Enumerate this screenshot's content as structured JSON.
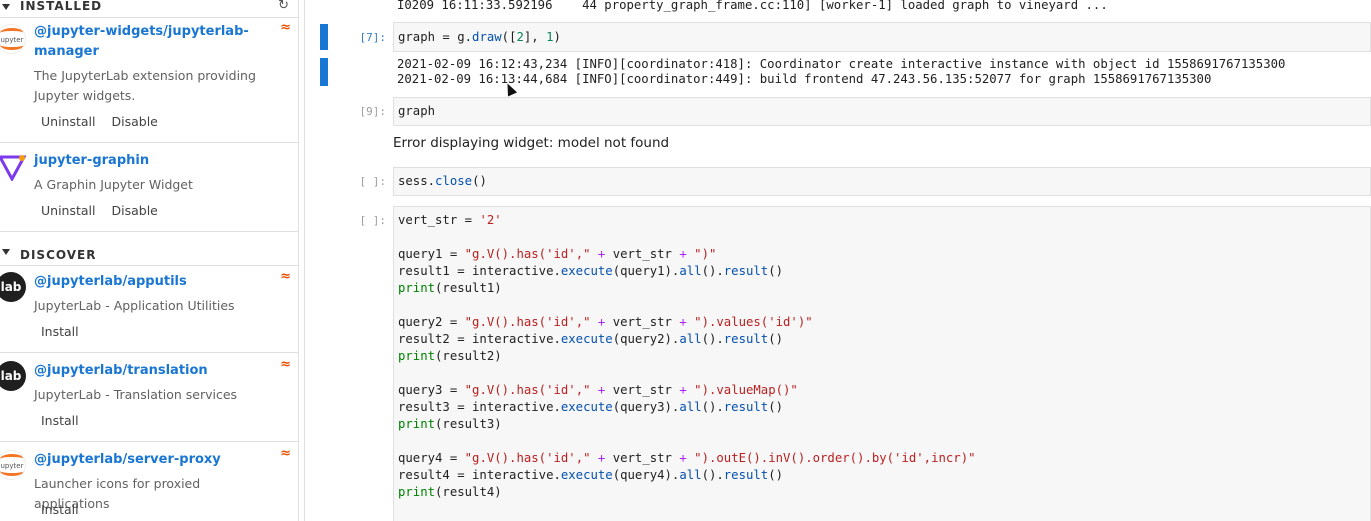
{
  "sidebar": {
    "installed_header": "INSTALLED",
    "discover_header": "DISCOVER",
    "installed": [
      {
        "name_line1": "@jupyter-widgets/jupyterlab-",
        "name_line2": "manager",
        "desc_line1": "The JupyterLab extension providing",
        "desc_line2": "Jupyter widgets.",
        "action1": "Uninstall",
        "action2": "Disable",
        "logo": "jupyter-logo-icon"
      },
      {
        "name": "jupyter-graphin",
        "desc": "A Graphin Jupyter Widget",
        "action1": "Uninstall",
        "action2": "Disable",
        "logo": "graphin-logo-icon"
      }
    ],
    "discover": [
      {
        "name": "@jupyterlab/apputils",
        "desc": "JupyterLab - Application Utilities",
        "action": "Install",
        "logo_text": "lab"
      },
      {
        "name": "@jupyterlab/translation",
        "desc": "JupyterLab - Translation services",
        "action": "Install",
        "logo_text": "lab"
      },
      {
        "name": "@jupyterlab/server-proxy",
        "desc": "Launcher icons for proxied applications",
        "action": "Install",
        "logo_text": "jupyter"
      }
    ]
  },
  "notebook": {
    "top_output": "I0209 16:11:33.592196    44 property_graph_frame.cc:110] [worker-1] loaded graph to vineyard ...",
    "cells": [
      {
        "prompt": "[7]:",
        "output_line1": "2021-02-09 16:12:43,234 [INFO][coordinator:418]: Coordinator create interactive instance with object id 1558691767135300",
        "output_line2": "2021-02-09 16:13:44,684 [INFO][coordinator:449]: build frontend 47.243.56.135:52077 for graph 1558691767135300"
      },
      {
        "prompt": "[9]:",
        "code": "graph",
        "output": "Error displaying widget: model not found"
      },
      {
        "prompt": "[ ]:",
        "code_obj": "sess",
        "code_fn": "close"
      },
      {
        "prompt": "[ ]:"
      }
    ]
  }
}
